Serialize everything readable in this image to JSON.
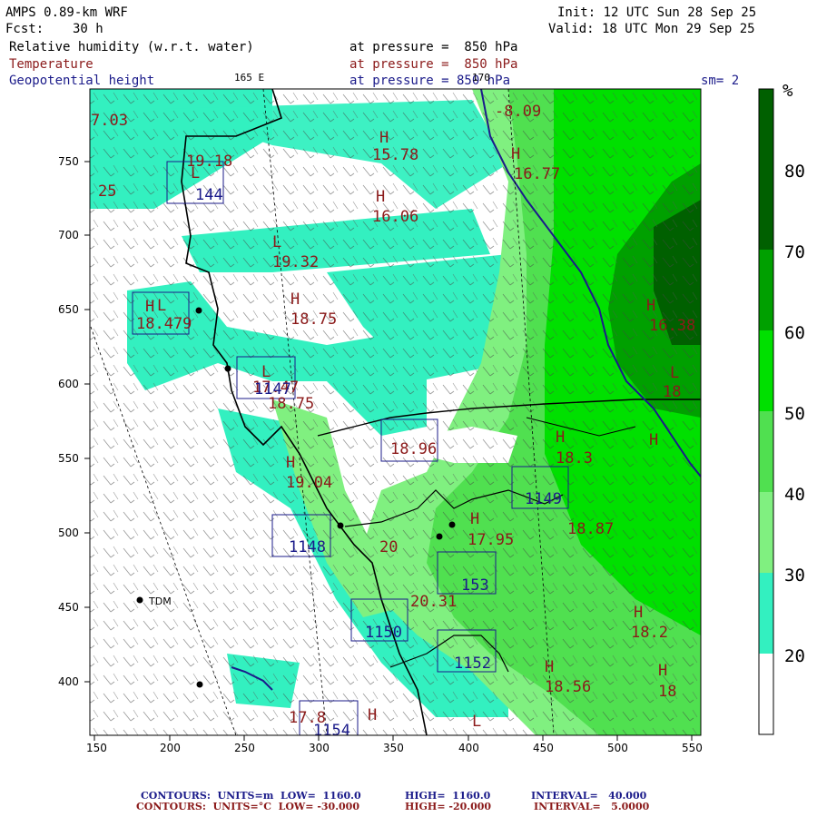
{
  "header": {
    "model": "AMPS 0.89-km WRF",
    "fcst_label": "Fcst:",
    "fcst_value": "30 h",
    "init": "Init: 12 UTC Sun 28 Sep 25",
    "valid": "Valid: 18 UTC Mon 29 Sep 25",
    "field1": "Relative humidity (w.r.t. water)",
    "field1_level": "at pressure =  850 hPa",
    "field2": "Temperature",
    "field2_level": "at pressure =  850 hPa",
    "field3": "Geopotential height",
    "field3_level": "at pressure = 850 hPa",
    "lon_label_1": "165 E",
    "lon_label_2": "170",
    "smoothing": "sm= 2"
  },
  "colorbar": {
    "unit": "%",
    "levels": [
      "20",
      "30",
      "40",
      "50",
      "60",
      "70",
      "80"
    ],
    "colors": [
      "#ffffff",
      "#33f0c0",
      "#80f080",
      "#50e050",
      "#00e000",
      "#00a000",
      "#006000"
    ]
  },
  "axes": {
    "x_ticks": [
      "150",
      "200",
      "250",
      "300",
      "350",
      "400",
      "450",
      "500",
      "550"
    ],
    "y_ticks": [
      "750",
      "700",
      "650",
      "600",
      "550",
      "500",
      "450",
      "400"
    ]
  },
  "stations": [
    {
      "label": "TDM"
    }
  ],
  "map_labels": {
    "temps": [
      "7.03",
      "19.18",
      "15.78",
      "16.77",
      "16.06",
      "19.32",
      "18.75",
      "18.479",
      "16.38",
      "17.47",
      "18.75",
      "18.96",
      "18.3",
      "19.04",
      "18.87",
      "20",
      "17.95",
      "20.31",
      "18.2",
      "18.56",
      "18",
      "17.8",
      "18",
      "25",
      "-8.09"
    ],
    "heights": [
      "144",
      "1147",
      "1149",
      "1148",
      "153",
      "1150",
      "1152",
      "1154"
    ],
    "highs": [
      "H",
      "H",
      "H",
      "H",
      "H",
      "H",
      "H",
      "H",
      "H",
      "H",
      "H",
      "H",
      "H",
      "H"
    ],
    "lows": [
      "L",
      "L",
      "L",
      "L",
      "L",
      "L"
    ]
  },
  "footer": {
    "line1_a": "CONTOURS:  UNITS=m  LOW=  1160.0",
    "line1_b": "HIGH=  1160.0",
    "line1_c": "INTERVAL=   40.000",
    "line2_a": "CONTOURS:  UNITS=°C  LOW= -30.000",
    "line2_b": "HIGH= -20.000",
    "line2_c": "INTERVAL=   5.0000"
  }
}
